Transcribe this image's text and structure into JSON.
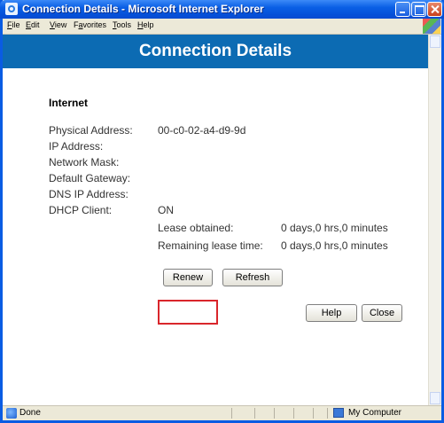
{
  "window": {
    "title": "Connection Details - Microsoft Internet Explorer"
  },
  "menu": {
    "items": [
      {
        "label": "File",
        "accel": "F"
      },
      {
        "label": "Edit",
        "accel": "E"
      },
      {
        "label": "View",
        "accel": "V"
      },
      {
        "label": "Favorites",
        "accel": "a"
      },
      {
        "label": "Tools",
        "accel": "T"
      },
      {
        "label": "Help",
        "accel": "H"
      }
    ]
  },
  "page": {
    "banner_title": "Connection Details",
    "section_title": "Internet",
    "fields": [
      {
        "label": "Physical Address:",
        "value": "00-c0-02-a4-d9-9d"
      },
      {
        "label": "IP Address:",
        "value": ""
      },
      {
        "label": "Network Mask:",
        "value": ""
      },
      {
        "label": "Default Gateway:",
        "value": ""
      },
      {
        "label": "DNS IP Address:",
        "value": ""
      },
      {
        "label": "DHCP Client:",
        "value": "ON"
      }
    ],
    "lease": [
      {
        "label": "Lease obtained:",
        "value": "0 days,0 hrs,0 minutes"
      },
      {
        "label": "Remaining lease time:",
        "value": "0 days,0 hrs,0 minutes"
      }
    ],
    "buttons": {
      "renew": "Renew",
      "refresh": "Refresh",
      "help": "Help",
      "close": "Close"
    }
  },
  "statusbar": {
    "status": "Done",
    "zone": "My Computer"
  },
  "colors": {
    "banner": "#0c6bb3",
    "titlebar": "#0a5fe5",
    "highlight": "#d9262b"
  }
}
